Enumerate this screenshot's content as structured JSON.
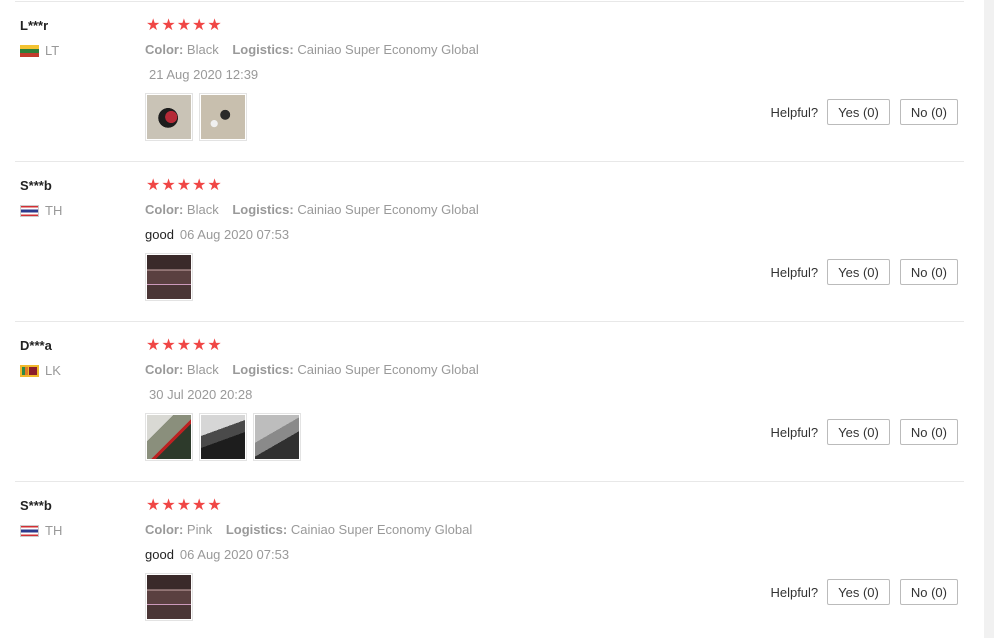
{
  "helpful_label": "Helpful?",
  "star_color": "#f04645",
  "reviews": [
    {
      "user": "L***r",
      "country": "LT",
      "flag_icon": "lithuania-flag-icon",
      "rating": 5,
      "stars": "★★★★★",
      "color_label": "Color:",
      "color_value": "Black",
      "logistics_label": "Logistics:",
      "logistics_value": "Cainiao Super Economy Global",
      "text": "",
      "date": "21 Aug 2020 12:39",
      "yes": "Yes (0)",
      "no": "No (0)"
    },
    {
      "user": "S***b",
      "country": "TH",
      "flag_icon": "thailand-flag-icon",
      "rating": 5,
      "stars": "★★★★★",
      "color_label": "Color:",
      "color_value": "Black",
      "logistics_label": "Logistics:",
      "logistics_value": "Cainiao Super Economy Global",
      "text": "good",
      "date": "06 Aug 2020 07:53",
      "yes": "Yes (0)",
      "no": "No (0)"
    },
    {
      "user": "D***a",
      "country": "LK",
      "flag_icon": "sri-lanka-flag-icon",
      "rating": 5,
      "stars": "★★★★★",
      "color_label": "Color:",
      "color_value": "Black",
      "logistics_label": "Logistics:",
      "logistics_value": "Cainiao Super Economy Global",
      "text": "",
      "date": "30 Jul 2020 20:28",
      "yes": "Yes (0)",
      "no": "No (0)"
    },
    {
      "user": "S***b",
      "country": "TH",
      "flag_icon": "thailand-flag-icon",
      "rating": 5,
      "stars": "★★★★★",
      "color_label": "Color:",
      "color_value": "Pink",
      "logistics_label": "Logistics:",
      "logistics_value": "Cainiao Super Economy Global",
      "text": "good",
      "date": "06 Aug 2020 07:53",
      "yes": "Yes (0)",
      "no": "No (0)"
    }
  ]
}
